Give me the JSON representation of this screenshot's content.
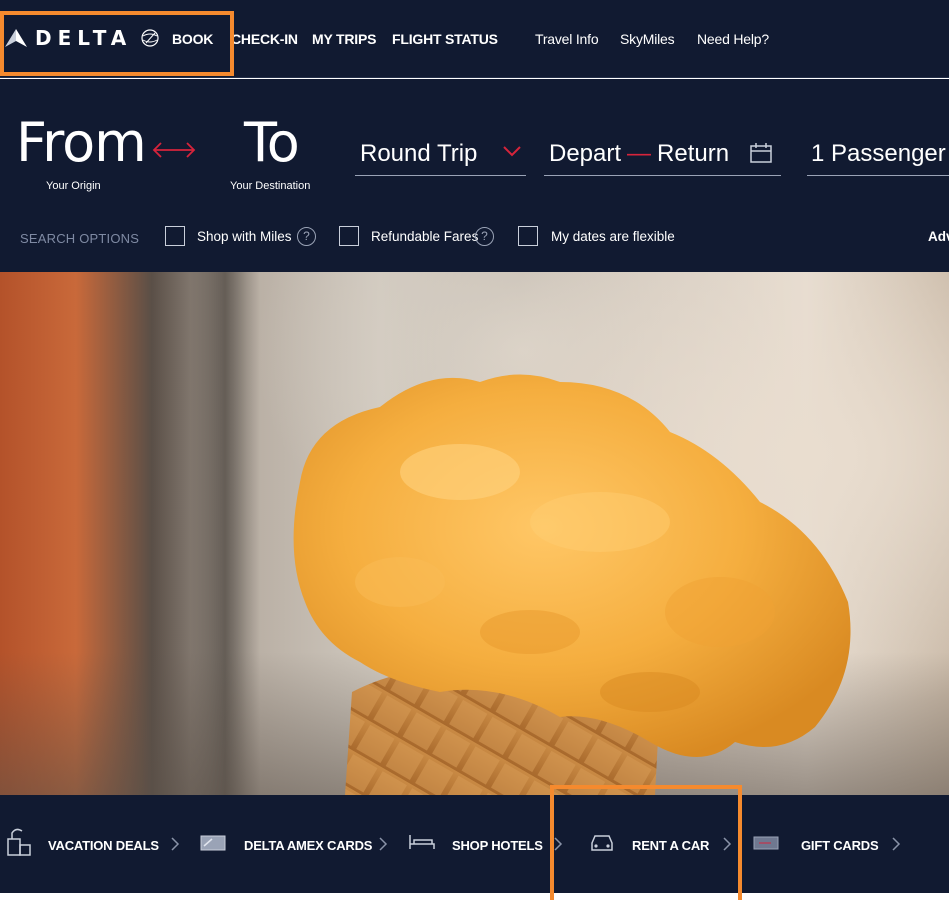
{
  "brand": {
    "name": "DELTA"
  },
  "nav": {
    "primary": [
      "BOOK",
      "CHECK-IN",
      "MY TRIPS",
      "FLIGHT STATUS"
    ],
    "secondary": [
      "Travel Info",
      "SkyMiles",
      "Need Help?"
    ]
  },
  "search": {
    "from": {
      "word": "From",
      "label": "Your Origin"
    },
    "to": {
      "word": "To",
      "label": "Your Destination"
    },
    "trip_type": "Round Trip",
    "depart": "Depart",
    "return": "Return",
    "passengers": "1 Passenger",
    "options_title": "SEARCH OPTIONS",
    "checkboxes": [
      "Shop with Miles",
      "Refundable Fares",
      "My dates are flexible"
    ],
    "help_glyph": "?",
    "advanced": "Adv"
  },
  "hero": {
    "subject": "ice-cream-cone"
  },
  "bottom_links": [
    "VACATION DEALS",
    "DELTA AMEX CARDS",
    "SHOP HOTELS",
    "RENT A CAR",
    "GIFT CARDS"
  ],
  "colors": {
    "navy": "#111a31",
    "accent_red": "#d6243b",
    "highlight_orange": "#f58a2e"
  },
  "icons": [
    "delta-widget-icon",
    "swap-arrows-icon",
    "chevron-down-icon",
    "calendar-icon",
    "help-icon",
    "vacation-icon",
    "credit-card-icon",
    "bed-icon",
    "car-icon",
    "gift-card-icon",
    "chevron-right-icon"
  ]
}
